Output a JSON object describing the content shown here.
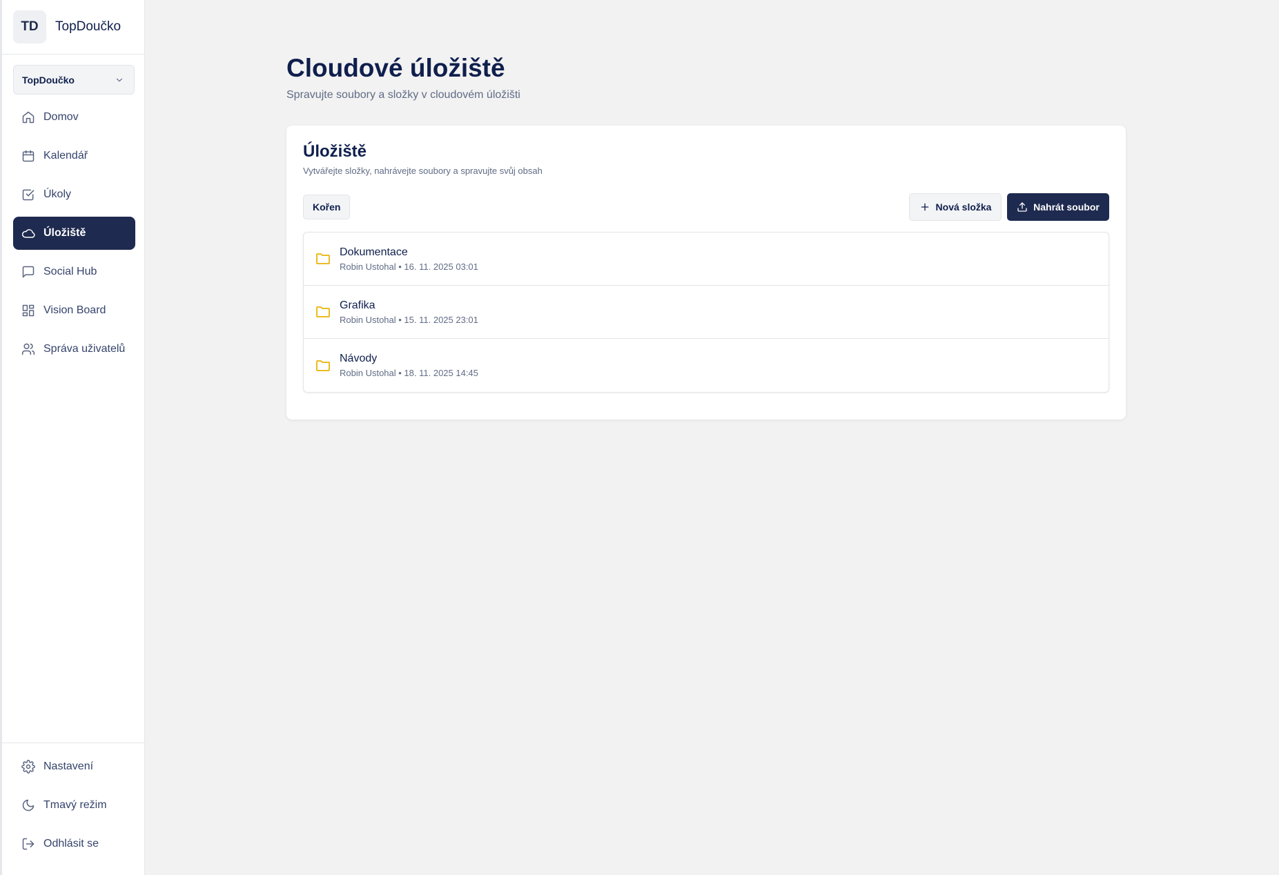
{
  "brand": {
    "initials": "TD",
    "name": "TopDoučko"
  },
  "org_select": {
    "value": "TopDoučko"
  },
  "nav": {
    "items": [
      {
        "label": "Domov",
        "icon": "home-icon"
      },
      {
        "label": "Kalendář",
        "icon": "calendar-icon"
      },
      {
        "label": "Úkoly",
        "icon": "check-square-icon"
      },
      {
        "label": "Úložiště",
        "icon": "cloud-icon",
        "active": true
      },
      {
        "label": "Social Hub",
        "icon": "message-icon"
      },
      {
        "label": "Vision Board",
        "icon": "grid-icon"
      },
      {
        "label": "Správa uživatelů",
        "icon": "users-icon"
      }
    ],
    "bottom": [
      {
        "label": "Nastavení",
        "icon": "gear-icon"
      },
      {
        "label": "Tmavý režim",
        "icon": "moon-icon"
      },
      {
        "label": "Odhlásit se",
        "icon": "logout-icon"
      }
    ]
  },
  "page": {
    "title": "Cloudové úložiště",
    "subtitle": "Spravujte soubory a složky v cloudovém úložišti"
  },
  "storage": {
    "title": "Úložiště",
    "subtitle": "Vytvářejte složky, nahrávejte soubory a spravujte svůj obsah",
    "breadcrumb": "Kořen",
    "new_folder_label": "Nová složka",
    "upload_label": "Nahrát soubor",
    "folders": [
      {
        "name": "Dokumentace",
        "meta": "Robin Ustohal • 16. 11. 2025 03:01"
      },
      {
        "name": "Grafika",
        "meta": "Robin Ustohal • 15. 11. 2025 23:01"
      },
      {
        "name": "Návody",
        "meta": "Robin Ustohal • 18. 11. 2025 14:45"
      }
    ]
  },
  "colors": {
    "accent": "#1e2a4f",
    "folder": "#eab308",
    "background": "#f2f2f2"
  }
}
